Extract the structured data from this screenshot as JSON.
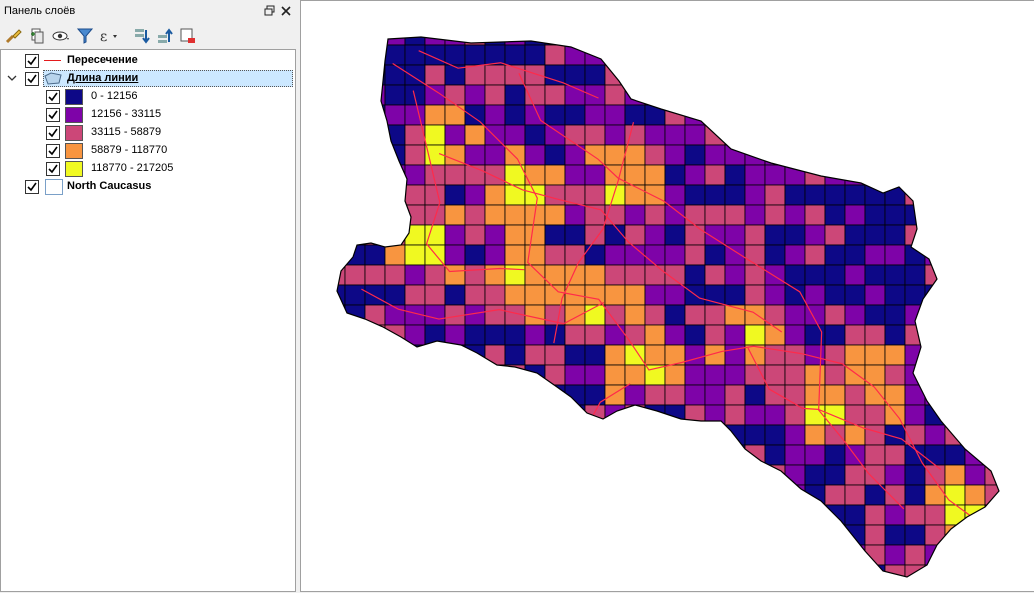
{
  "panel": {
    "title": "Панель слоёв",
    "float_icon": "restore-icon",
    "close_icon": "close-icon"
  },
  "toolbar": {
    "tools": [
      {
        "name": "style-manager-icon"
      },
      {
        "name": "add-group-icon"
      },
      {
        "name": "visibility-icon"
      },
      {
        "name": "filter-legend-icon"
      },
      {
        "name": "expression-filter-icon"
      },
      {
        "name": "expand-all-icon"
      },
      {
        "name": "collapse-all-icon"
      },
      {
        "name": "remove-layer-icon"
      }
    ]
  },
  "layers": [
    {
      "label": "Пересечение",
      "checked": true,
      "type": "line",
      "line_color": "#e41a1c"
    },
    {
      "label": "Длина линии",
      "checked": true,
      "type": "polygon",
      "expanded": true,
      "selected": true,
      "classes": [
        {
          "label": "0 - 12156",
          "color": "#0d0887",
          "checked": true
        },
        {
          "label": "12156 - 33115",
          "color": "#7e03a8",
          "checked": true
        },
        {
          "label": "33115 - 58879",
          "color": "#cc4778",
          "checked": true
        },
        {
          "label": "58879 - 118770",
          "color": "#f89540",
          "checked": true
        },
        {
          "label": "118770 - 217205",
          "color": "#f0f921",
          "checked": true
        }
      ]
    },
    {
      "label": "North Caucasus",
      "checked": true,
      "type": "polygon-outline"
    }
  ],
  "map": {
    "background": "#ffffff",
    "road_color": "#ff2a4a",
    "grid_color": "#000000"
  }
}
